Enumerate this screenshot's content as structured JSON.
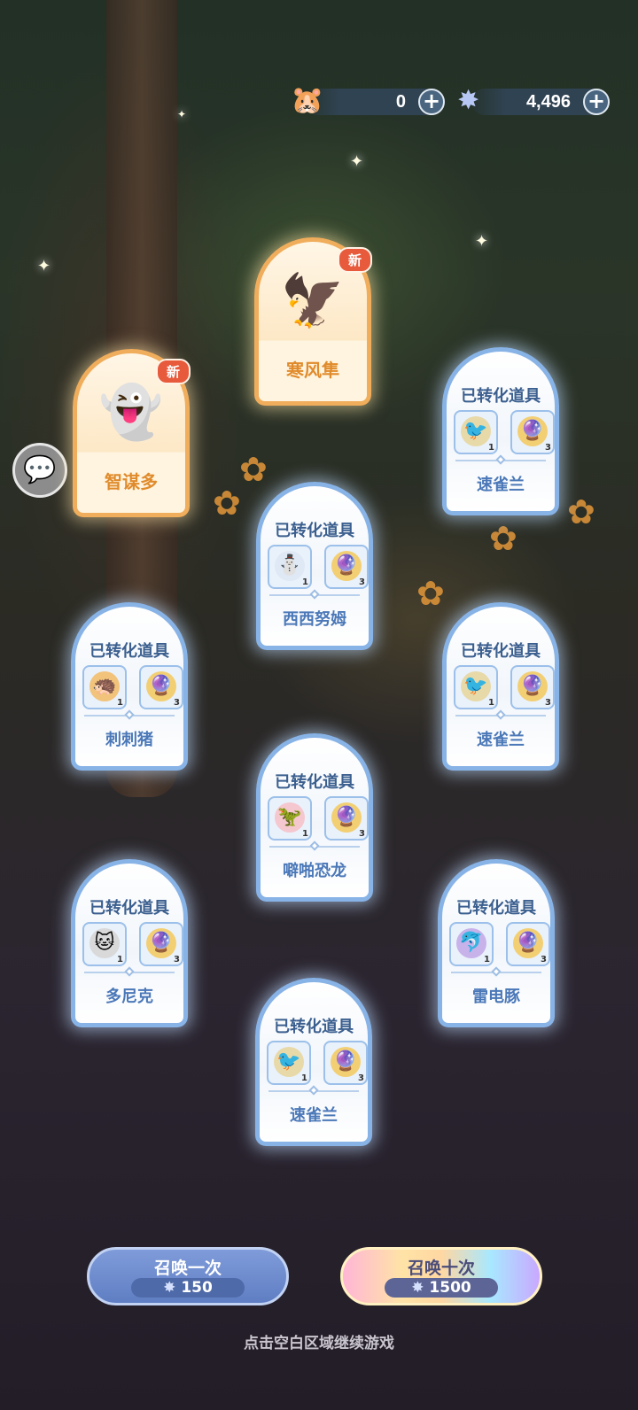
{
  "currencies": [
    {
      "icon": "pet-food-icon",
      "value": "0"
    },
    {
      "icon": "star-crystal-icon",
      "value": "4,496"
    }
  ],
  "new_badge": "新",
  "converted_label": "已转化道具",
  "new_pets": [
    {
      "name": "寒风隼",
      "icon": "white-bird-pet-icon"
    },
    {
      "name": "智谋多",
      "icon": "ghost-book-pet-icon"
    }
  ],
  "converted_cards": [
    {
      "name": "速雀兰",
      "item1_qty": "1",
      "item2_qty": "3"
    },
    {
      "name": "西西努姆",
      "item1_qty": "1",
      "item2_qty": "3"
    },
    {
      "name": "刺刺猪",
      "item1_qty": "1",
      "item2_qty": "3"
    },
    {
      "name": "速雀兰",
      "item1_qty": "1",
      "item2_qty": "3"
    },
    {
      "name": "噼啪恐龙",
      "item1_qty": "1",
      "item2_qty": "3"
    },
    {
      "name": "多尼克",
      "item1_qty": "1",
      "item2_qty": "3"
    },
    {
      "name": "雷电豚",
      "item1_qty": "1",
      "item2_qty": "3"
    },
    {
      "name": "速雀兰",
      "item1_qty": "1",
      "item2_qty": "3"
    }
  ],
  "summon_once": {
    "label": "召唤一次",
    "cost": "150"
  },
  "summon_ten": {
    "label": "召唤十次",
    "cost": "1500"
  },
  "hint": "点击空白区域继续游戏"
}
